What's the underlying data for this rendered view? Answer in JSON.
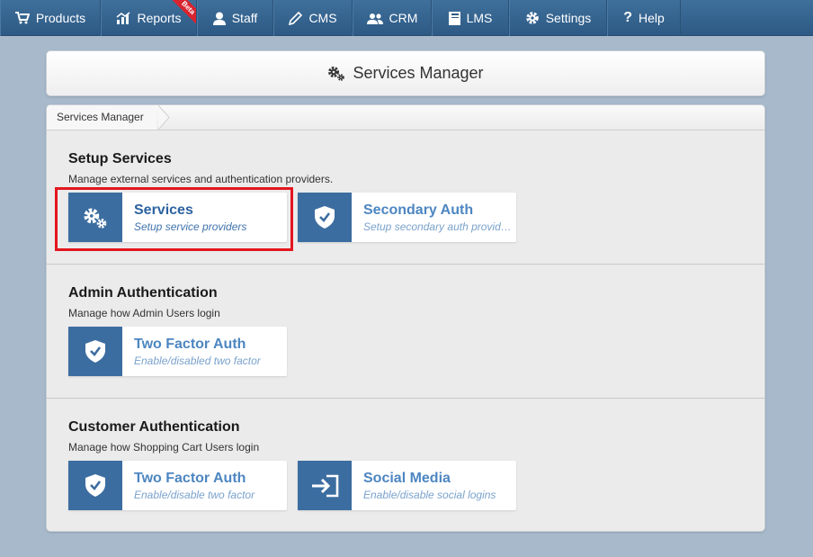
{
  "nav": {
    "items": [
      {
        "label": "Products",
        "icon": "cart-icon"
      },
      {
        "label": "Reports",
        "icon": "chart-icon",
        "badge": "Beta"
      },
      {
        "label": "Staff",
        "icon": "user-icon"
      },
      {
        "label": "CMS",
        "icon": "pencil-icon"
      },
      {
        "label": "CRM",
        "icon": "users-icon"
      },
      {
        "label": "LMS",
        "icon": "book-icon"
      },
      {
        "label": "Settings",
        "icon": "gear-icon"
      },
      {
        "label": "Help",
        "icon": "question-icon"
      }
    ]
  },
  "header": {
    "title": "Services Manager",
    "icon": "gears-icon"
  },
  "breadcrumb": {
    "current": "Services Manager"
  },
  "sections": [
    {
      "title": "Setup Services",
      "description": "Manage external services and authentication providers.",
      "cards": [
        {
          "title": "Services",
          "subtitle": "Setup service providers",
          "icon": "gears-icon"
        },
        {
          "title": "Secondary Auth",
          "subtitle": "Setup secondary auth providers",
          "icon": "shield-check-icon"
        }
      ]
    },
    {
      "title": "Admin Authentication",
      "description": "Manage how Admin Users login",
      "cards": [
        {
          "title": "Two Factor Auth",
          "subtitle": "Enable/disabled two factor",
          "icon": "shield-check-icon"
        }
      ]
    },
    {
      "title": "Customer Authentication",
      "description": "Manage how Shopping Cart Users login",
      "cards": [
        {
          "title": "Two Factor Auth",
          "subtitle": "Enable/disable two factor",
          "icon": "shield-check-icon"
        },
        {
          "title": "Social Media",
          "subtitle": "Enable/disable social logins",
          "icon": "sign-in-icon"
        }
      ]
    }
  ],
  "colors": {
    "nav_bg": "#2d5a85",
    "card_icon_bg": "#3c6da0",
    "card_title": "#4d86c1",
    "highlight": "#e3161f",
    "beta_badge": "#d9232e"
  }
}
